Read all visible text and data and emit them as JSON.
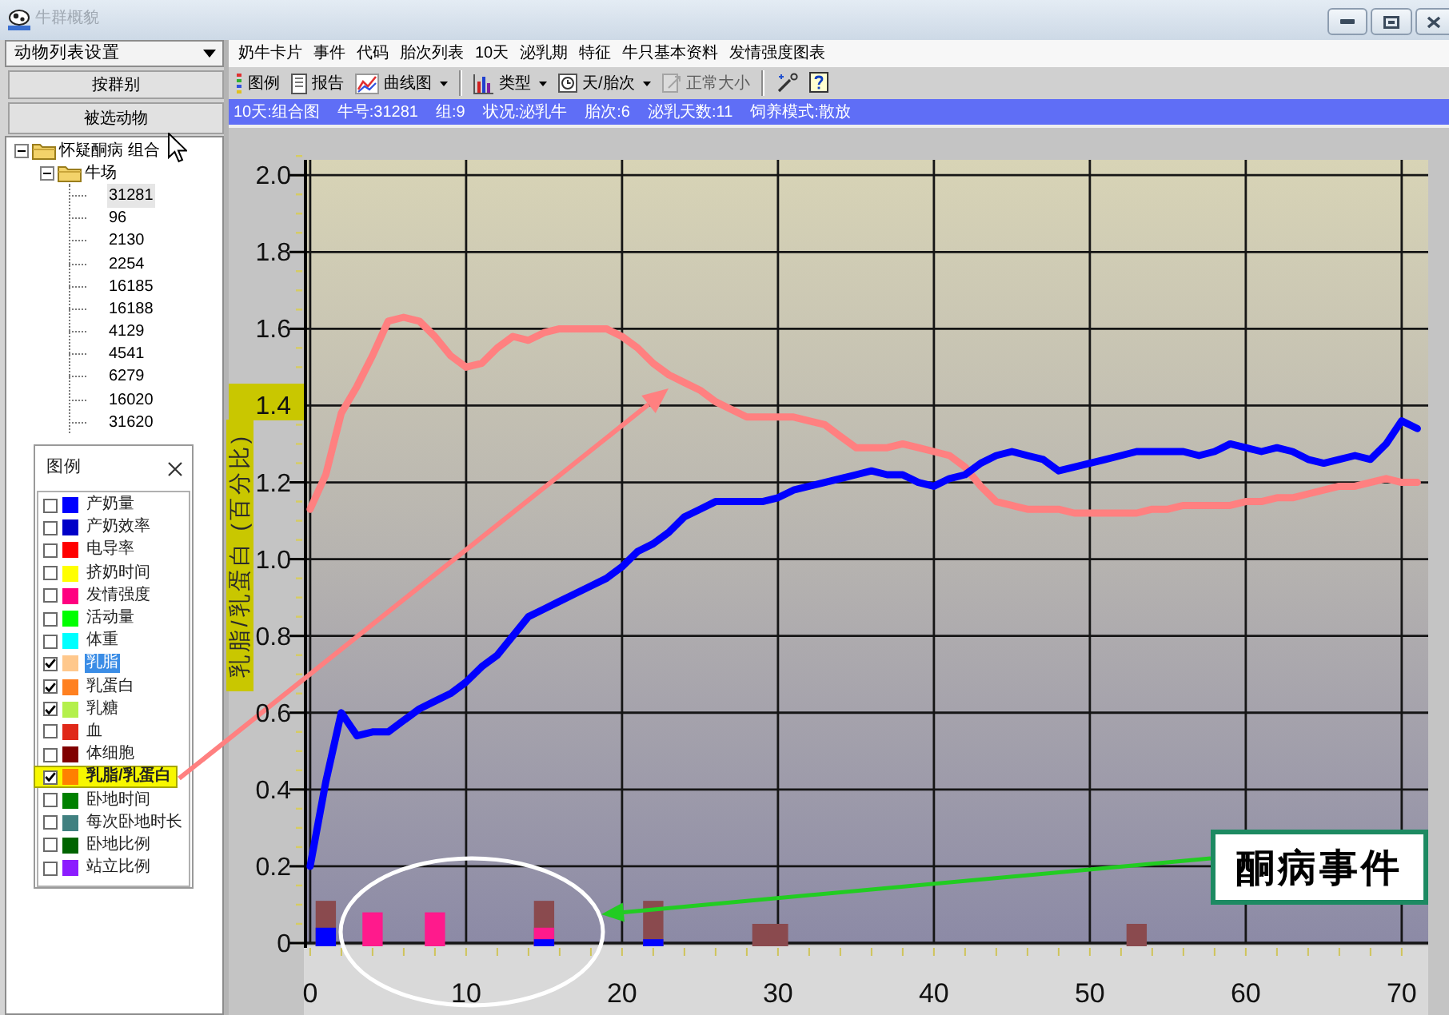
{
  "window": {
    "title": "牛群概貌"
  },
  "sidebar": {
    "dropdown": {
      "value": "动物列表设置"
    },
    "buttons": [
      {
        "label": "按群别"
      },
      {
        "label": "被选动物"
      }
    ],
    "tree": [
      {
        "label": "怀疑酮病 组合",
        "expanded": true,
        "selected": false,
        "children": [
          {
            "label": "牛场",
            "expanded": true,
            "selected": false,
            "children": [
              {
                "label": "31281",
                "selected": true
              },
              {
                "label": "96",
                "selected": false
              },
              {
                "label": "2130",
                "selected": false
              },
              {
                "label": "2254",
                "selected": false
              },
              {
                "label": "16185",
                "selected": false
              },
              {
                "label": "16188",
                "selected": false
              },
              {
                "label": "4129",
                "selected": false
              },
              {
                "label": "4541",
                "selected": false
              },
              {
                "label": "6279",
                "selected": false
              },
              {
                "label": "16020",
                "selected": false
              },
              {
                "label": "31620",
                "selected": false
              }
            ]
          }
        ]
      }
    ]
  },
  "legend": {
    "title": "图例",
    "items": [
      {
        "label": "产奶量",
        "color": "#0000ff",
        "checked": false,
        "selected": false,
        "highlighted": false
      },
      {
        "label": "产奶效率",
        "color": "#0000c8",
        "checked": false,
        "selected": false,
        "highlighted": false
      },
      {
        "label": "电导率",
        "color": "#ff0000",
        "checked": false,
        "selected": false,
        "highlighted": false
      },
      {
        "label": "挤奶时间",
        "color": "#ffff00",
        "checked": false,
        "selected": false,
        "highlighted": false
      },
      {
        "label": "发情强度",
        "color": "#ff0080",
        "checked": false,
        "selected": false,
        "highlighted": false
      },
      {
        "label": "活动量",
        "color": "#00ff00",
        "checked": false,
        "selected": false,
        "highlighted": false
      },
      {
        "label": "体重",
        "color": "#00ffff",
        "checked": false,
        "selected": false,
        "highlighted": false
      },
      {
        "label": "乳脂",
        "color": "#ffc88c",
        "checked": true,
        "selected": true,
        "highlighted": false
      },
      {
        "label": "乳蛋白",
        "color": "#ff8020",
        "checked": true,
        "selected": false,
        "highlighted": false
      },
      {
        "label": "乳糖",
        "color": "#b4f04c",
        "checked": true,
        "selected": false,
        "highlighted": false
      },
      {
        "label": "血",
        "color": "#e02818",
        "checked": false,
        "selected": false,
        "highlighted": false
      },
      {
        "label": "体细胞",
        "color": "#800000",
        "checked": false,
        "selected": false,
        "highlighted": false
      },
      {
        "label": "乳脂/乳蛋白",
        "color": "#ff8000",
        "checked": true,
        "selected": false,
        "highlighted": true
      },
      {
        "label": "卧地时间",
        "color": "#008000",
        "checked": false,
        "selected": false,
        "highlighted": false
      },
      {
        "label": "每次卧地时长",
        "color": "#408080",
        "checked": false,
        "selected": false,
        "highlighted": false
      },
      {
        "label": "卧地比例",
        "color": "#006400",
        "checked": false,
        "selected": false,
        "highlighted": false
      },
      {
        "label": "站立比例",
        "color": "#8c1cff",
        "checked": false,
        "selected": false,
        "highlighted": false
      }
    ]
  },
  "menu": [
    {
      "label": "奶牛卡片"
    },
    {
      "label": "事件"
    },
    {
      "label": "代码"
    },
    {
      "label": "胎次列表"
    },
    {
      "label": "10天"
    },
    {
      "label": "泌乳期"
    },
    {
      "label": "特征"
    },
    {
      "label": "牛只基本资料"
    },
    {
      "label": "发情强度图表"
    }
  ],
  "toolbar": [
    {
      "kind": "button",
      "label": "图例",
      "disabled": false
    },
    {
      "kind": "button",
      "label": "报告",
      "disabled": false
    },
    {
      "kind": "dropdown",
      "label": "曲线图",
      "disabled": false
    },
    {
      "kind": "separator"
    },
    {
      "kind": "dropdown",
      "label": "类型",
      "disabled": false
    },
    {
      "kind": "dropdown",
      "label": "天/胎次",
      "disabled": false
    },
    {
      "kind": "button",
      "label": "正常大小",
      "disabled": true
    },
    {
      "kind": "separator"
    },
    {
      "kind": "icon",
      "disabled": false
    },
    {
      "kind": "icon",
      "disabled": false
    }
  ],
  "info_bar": [
    "10天:组合图",
    "牛号:31281",
    "组:9",
    "状况:泌乳牛",
    "胎次:6",
    "泌乳天数:11",
    "饲养模式:散放"
  ],
  "chart": {
    "chart_data": {
      "type": "line",
      "ylabel": "乳脂/乳蛋白 (百分比)",
      "grid": true,
      "x": [
        0,
        1,
        2,
        3,
        4,
        5,
        6,
        7,
        8,
        9,
        10,
        11,
        12,
        13,
        14,
        15,
        16,
        17,
        18,
        19,
        20,
        21,
        22,
        23,
        24,
        25,
        26,
        27,
        28,
        29,
        30,
        31,
        32,
        33,
        34,
        35,
        36,
        37,
        38,
        39,
        40,
        41,
        42,
        43,
        44,
        45,
        46,
        47,
        48,
        49,
        50,
        51,
        52,
        53,
        54,
        55,
        56,
        57,
        58,
        59,
        60,
        61,
        62,
        63,
        64,
        65,
        66,
        67,
        68,
        69,
        70,
        71
      ],
      "series": [
        {
          "color": "#ff8080",
          "values": [
            1.13,
            1.22,
            1.38,
            1.45,
            1.53,
            1.62,
            1.63,
            1.62,
            1.58,
            1.53,
            1.5,
            1.51,
            1.55,
            1.58,
            1.57,
            1.59,
            1.6,
            1.6,
            1.6,
            1.6,
            1.58,
            1.55,
            1.51,
            1.48,
            1.46,
            1.44,
            1.41,
            1.39,
            1.37,
            1.37,
            1.37,
            1.37,
            1.36,
            1.35,
            1.32,
            1.29,
            1.29,
            1.29,
            1.3,
            1.29,
            1.28,
            1.27,
            1.24,
            1.19,
            1.15,
            1.14,
            1.13,
            1.13,
            1.13,
            1.12,
            1.12,
            1.12,
            1.12,
            1.12,
            1.13,
            1.13,
            1.14,
            1.14,
            1.14,
            1.14,
            1.15,
            1.15,
            1.16,
            1.16,
            1.17,
            1.18,
            1.19,
            1.19,
            1.2,
            1.21,
            1.2,
            1.2
          ]
        },
        {
          "color": "#0000ff",
          "values": [
            0.2,
            0.42,
            0.6,
            0.54,
            0.55,
            0.55,
            0.58,
            0.61,
            0.63,
            0.65,
            0.68,
            0.72,
            0.75,
            0.8,
            0.85,
            0.87,
            0.89,
            0.91,
            0.93,
            0.95,
            0.98,
            1.02,
            1.04,
            1.07,
            1.11,
            1.13,
            1.15,
            1.15,
            1.15,
            1.15,
            1.16,
            1.18,
            1.19,
            1.2,
            1.21,
            1.22,
            1.23,
            1.22,
            1.22,
            1.2,
            1.19,
            1.21,
            1.22,
            1.25,
            1.27,
            1.28,
            1.27,
            1.26,
            1.23,
            1.24,
            1.25,
            1.26,
            1.27,
            1.28,
            1.28,
            1.28,
            1.28,
            1.27,
            1.28,
            1.3,
            1.29,
            1.28,
            1.29,
            1.28,
            1.26,
            1.25,
            1.26,
            1.27,
            1.26,
            1.3,
            1.36,
            1.34
          ]
        },
        {
          "type": "bar",
          "color": "#8a4a4e",
          "values": [
            null,
            0.11,
            null,
            null,
            null,
            null,
            null,
            null,
            null,
            null,
            null,
            null,
            null,
            null,
            null,
            0.11,
            null,
            null,
            null,
            null,
            null,
            null,
            0.11,
            null,
            null,
            null,
            null,
            null,
            null,
            0.05,
            0.05,
            null,
            null,
            null,
            null,
            null,
            null,
            null,
            null,
            null,
            null,
            null,
            null,
            null,
            null,
            null,
            null,
            null,
            null,
            null,
            null,
            null,
            null,
            0.05,
            null,
            null,
            null,
            null,
            null,
            null,
            null,
            null,
            null,
            null,
            null,
            null,
            null,
            null,
            null,
            null,
            null,
            null
          ]
        },
        {
          "type": "bar",
          "color": "#ff1a8c",
          "values": [
            null,
            null,
            null,
            null,
            0.08,
            null,
            null,
            null,
            0.08,
            null,
            null,
            null,
            null,
            null,
            null,
            0.04,
            null,
            null,
            null,
            null,
            null,
            null,
            null,
            null,
            null,
            null,
            null,
            null,
            null,
            null,
            null,
            null,
            null,
            null,
            null,
            null,
            null,
            null,
            null,
            null,
            null,
            null,
            null,
            null,
            null,
            null,
            null,
            null,
            null,
            null,
            null,
            null,
            null,
            null,
            null,
            null,
            null,
            null,
            null,
            null,
            null,
            null,
            null,
            null,
            null,
            null,
            null,
            null,
            null,
            null,
            null,
            null
          ]
        },
        {
          "type": "bar",
          "color": "#0000ff",
          "values": [
            null,
            0.04,
            null,
            null,
            null,
            null,
            null,
            null,
            null,
            null,
            null,
            null,
            null,
            null,
            null,
            0.01,
            null,
            null,
            null,
            null,
            null,
            null,
            0.01,
            null,
            null,
            null,
            null,
            null,
            null,
            null,
            null,
            null,
            null,
            null,
            null,
            null,
            null,
            null,
            null,
            null,
            null,
            null,
            null,
            null,
            null,
            null,
            null,
            null,
            null,
            null,
            null,
            null,
            null,
            null,
            null,
            null,
            null,
            null,
            null,
            null,
            null,
            null,
            null,
            null,
            null,
            null,
            null,
            null,
            null,
            null,
            null,
            null
          ]
        }
      ],
      "xlim": [
        -0.2,
        71.7
      ],
      "ylim": [
        0,
        2.04
      ],
      "xticks": [
        0,
        10,
        20,
        30,
        40,
        50,
        60,
        70
      ],
      "yticks": [
        0,
        0.2,
        0.4,
        0.6,
        0.8,
        {
          "value": 1,
          "label": "1.0"
        },
        1.2,
        1.4,
        1.6,
        1.8,
        {
          "value": 2,
          "label": "2.0"
        }
      ]
    },
    "callout": "酮病事件"
  }
}
